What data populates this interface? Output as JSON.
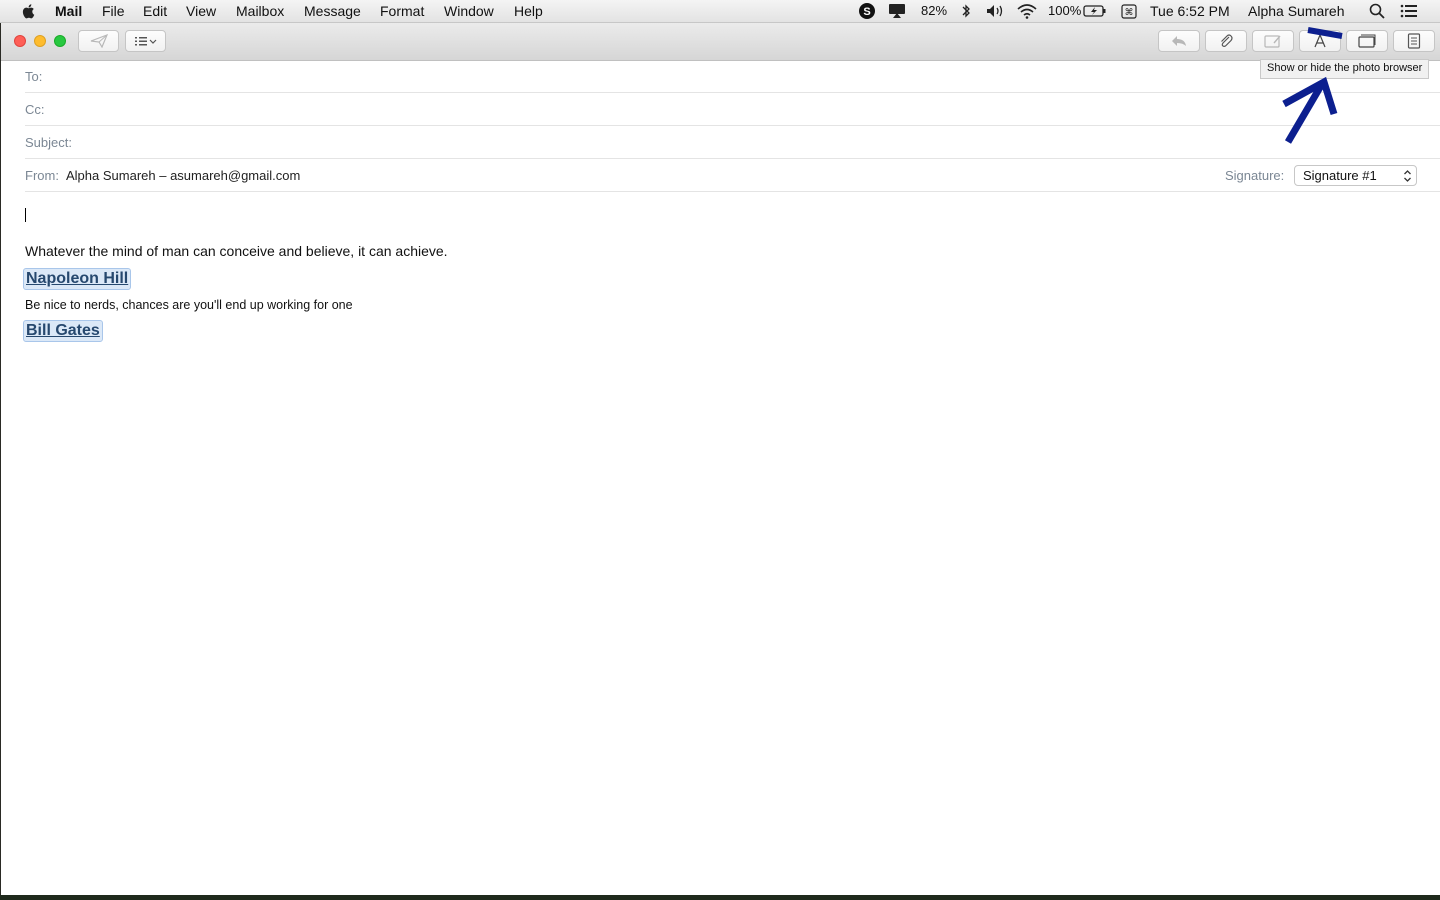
{
  "menubar": {
    "app_name": "Mail",
    "items": [
      "File",
      "Edit",
      "View",
      "Mailbox",
      "Message",
      "Format",
      "Window",
      "Help"
    ],
    "status": {
      "volume_percent": "82%",
      "battery_percent": "100%",
      "clock": "Tue 6:52 PM",
      "user": "Alpha Sumareh"
    }
  },
  "toolbar": {
    "send_icon": "paper-plane-icon",
    "header_fields_icon": "list-dropdown-icon",
    "right_icons": [
      "reply-arrow-icon",
      "paperclip-icon",
      "markup-icon",
      "font-a-icon",
      "photo-browser-icon",
      "stationery-icon"
    ]
  },
  "compose": {
    "to_label": "To:",
    "cc_label": "Cc:",
    "subject_label": "Subject:",
    "from_label": "From:",
    "from_value": "Alpha Sumareh – asumareh@gmail.com",
    "signature_label": "Signature:",
    "signature_value": "Signature #1"
  },
  "body": {
    "quote1": "Whatever the mind of man can conceive and believe, it can achieve.",
    "author1": "Napoleon Hill",
    "quote2": "Be nice to nerds, chances are you'll end up working for one",
    "author2": "Bill Gates"
  },
  "tooltip": "Show or hide the photo browser",
  "colors": {
    "close": "#fe5f57",
    "minimize": "#febc2e",
    "zoom": "#28c840",
    "annotation": "#0c1f8f",
    "link": "#26486e"
  }
}
